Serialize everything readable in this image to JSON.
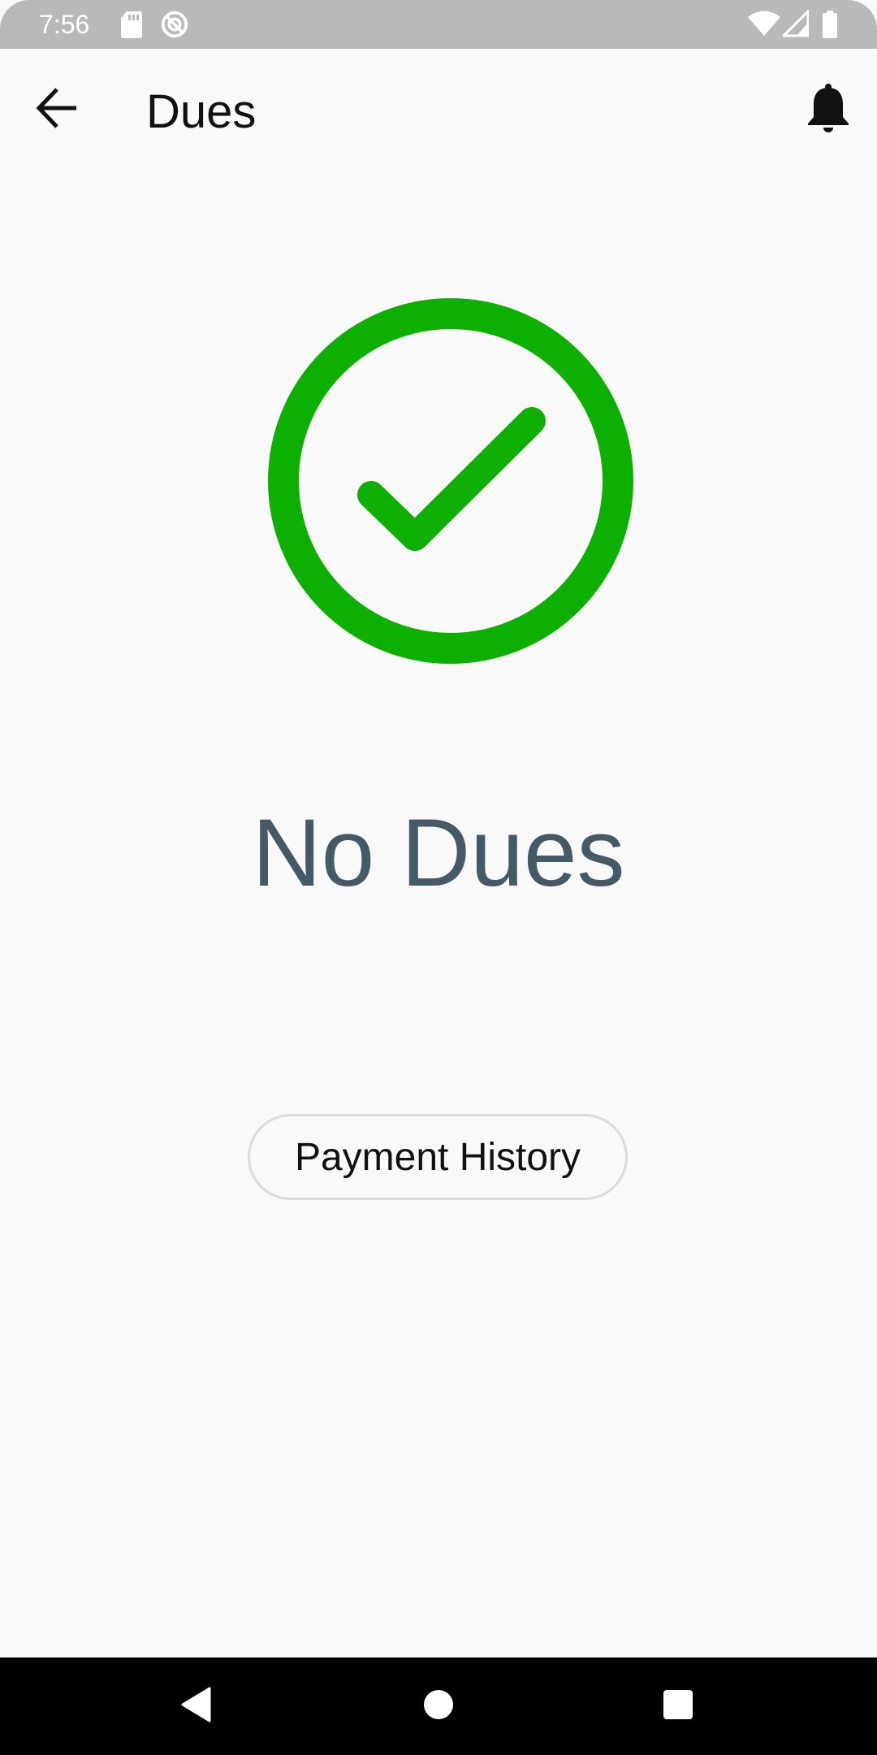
{
  "status_bar": {
    "time": "7:56",
    "icons": [
      "sd-card-icon",
      "do-not-disturb-icon",
      "wifi-icon",
      "cellular-signal-icon",
      "battery-icon"
    ]
  },
  "app_bar": {
    "title": "Dues",
    "back_icon": "arrow-back-icon",
    "notification_icon": "bell-icon"
  },
  "status": {
    "icon": "check-circle-icon",
    "icon_color": "#0daf00",
    "heading": "No Dues",
    "heading_color": "#455a64"
  },
  "actions": {
    "payment_history_label": "Payment History"
  },
  "nav_bar": {
    "buttons": [
      "back-triangle-icon",
      "home-circle-icon",
      "recents-square-icon"
    ]
  }
}
